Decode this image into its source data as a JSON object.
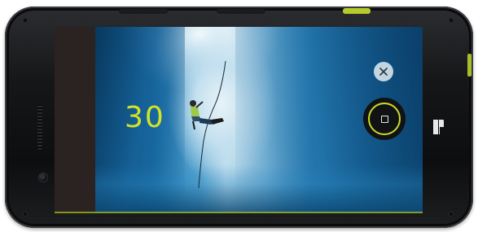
{
  "device": {
    "name": "rugged-phone",
    "accent_color": "#c9dc28"
  },
  "camera": {
    "mode": "video-recording",
    "countdown_value": "30",
    "close_icon": "close-icon",
    "shutter_icon": "stop-record-icon"
  }
}
